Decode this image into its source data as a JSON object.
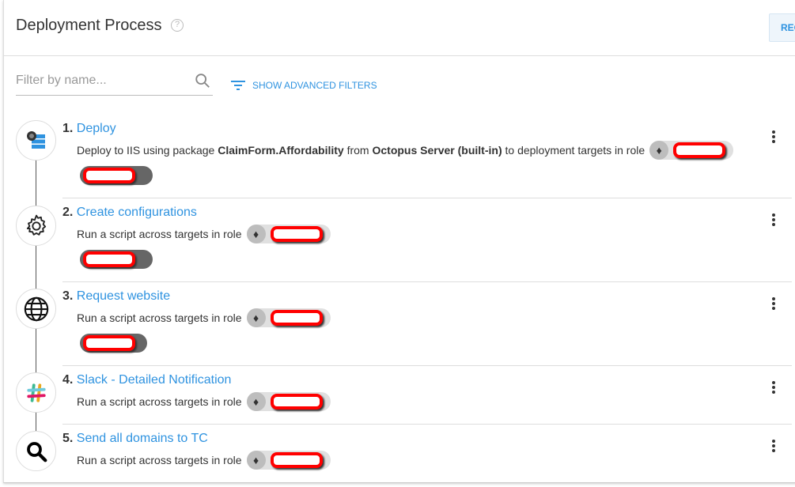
{
  "header": {
    "title": "Deployment Process",
    "help_icon": "help-circle-icon",
    "button_label": "REO"
  },
  "filter": {
    "placeholder": "Filter by name...",
    "value": "",
    "advanced_label": "SHOW ADVANCED FILTERS"
  },
  "colors": {
    "accent": "#2f93e0",
    "redaction": "#ff0000"
  },
  "steps": [
    {
      "num": "1.",
      "name": "Deploy",
      "icon": "iis-deploy-icon",
      "desc_parts": [
        "Deploy to IIS using package ",
        "ClaimForm.Affordability",
        " from ",
        "Octopus Server (built-in)",
        " to deployment targets in role"
      ]
    },
    {
      "num": "2.",
      "name": "Create configurations",
      "icon": "gear-icon",
      "desc": "Run a script across targets in role"
    },
    {
      "num": "3.",
      "name": "Request website",
      "icon": "globe-icon",
      "desc": "Run a script across targets in role"
    },
    {
      "num": "4.",
      "name": "Slack - Detailed Notification",
      "icon": "slack-icon",
      "desc": "Run a script across targets in role"
    },
    {
      "num": "5.",
      "name": "Send all domains to TC",
      "icon": "magnifier-icon",
      "desc": "Run a script across targets in role"
    }
  ]
}
